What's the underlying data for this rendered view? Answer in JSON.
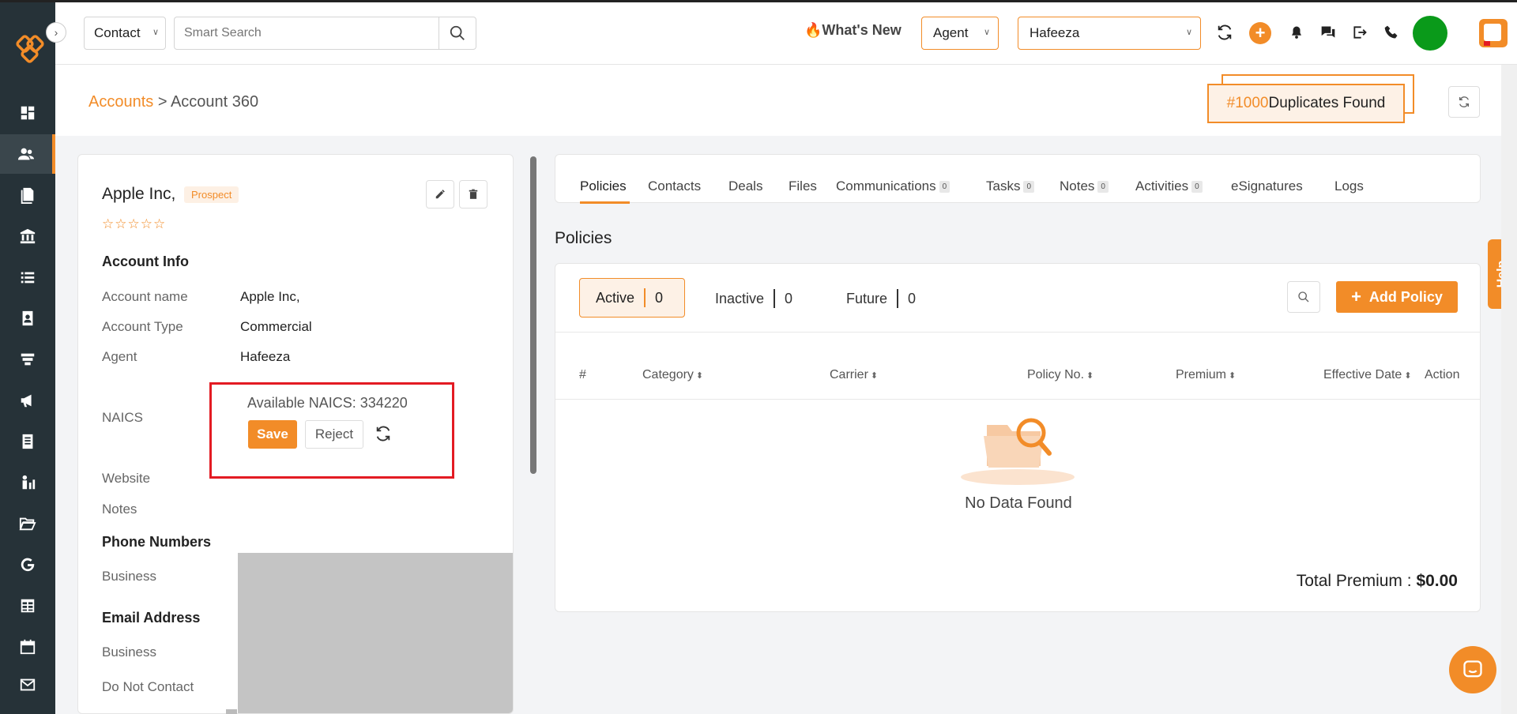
{
  "topbar": {
    "contact_select": "Contact",
    "search_placeholder": "Smart Search",
    "whats_new": "What's New",
    "agent_select": "Agent",
    "user_select": "Hafeeza"
  },
  "breadcrumb": {
    "root": "Accounts",
    "separator": ">",
    "current": "Account 360"
  },
  "duplicates": {
    "count": "#1000",
    "label": "Duplicates Found"
  },
  "account": {
    "name": "Apple Inc,",
    "status": "Prospect",
    "stars": "☆☆☆☆☆",
    "info_heading": "Account Info",
    "fields": {
      "name_label": "Account name",
      "name_value": "Apple Inc,",
      "type_label": "Account Type",
      "type_value": "Commercial",
      "agent_label": "Agent",
      "agent_value": "Hafeeza",
      "naics_label": "NAICS",
      "website_label": "Website",
      "notes_label": "Notes"
    },
    "naics": {
      "available_text": "Available NAICS: 334220",
      "save": "Save",
      "reject": "Reject"
    },
    "phone_heading": "Phone Numbers",
    "phone_business": "Business",
    "email_heading": "Email Address",
    "email_business": "Business",
    "do_not_contact": "Do Not Contact"
  },
  "tabs": [
    {
      "label": "Policies"
    },
    {
      "label": "Contacts"
    },
    {
      "label": "Deals"
    },
    {
      "label": "Files"
    },
    {
      "label": "Communications",
      "count": "0"
    },
    {
      "label": "Tasks",
      "count": "0"
    },
    {
      "label": "Notes",
      "count": "0"
    },
    {
      "label": "Activities",
      "count": "0"
    },
    {
      "label": "eSignatures"
    },
    {
      "label": "Logs"
    }
  ],
  "policies": {
    "heading": "Policies",
    "filters": {
      "active_label": "Active",
      "active_count": "0",
      "inactive_label": "Inactive",
      "inactive_count": "0",
      "future_label": "Future",
      "future_count": "0"
    },
    "add_button": "Add Policy",
    "columns": [
      "#",
      "Category",
      "Carrier",
      "Policy No.",
      "Premium",
      "Effective Date",
      "Action"
    ],
    "empty_text": "No Data Found",
    "total_label": "Total Premium :",
    "total_value": "$0.00"
  },
  "help_tab": "Help",
  "colors": {
    "accent": "#f28c28",
    "sidebar": "#263238",
    "highlight_box": "#e31b23",
    "avatar": "#0a9a1a"
  }
}
